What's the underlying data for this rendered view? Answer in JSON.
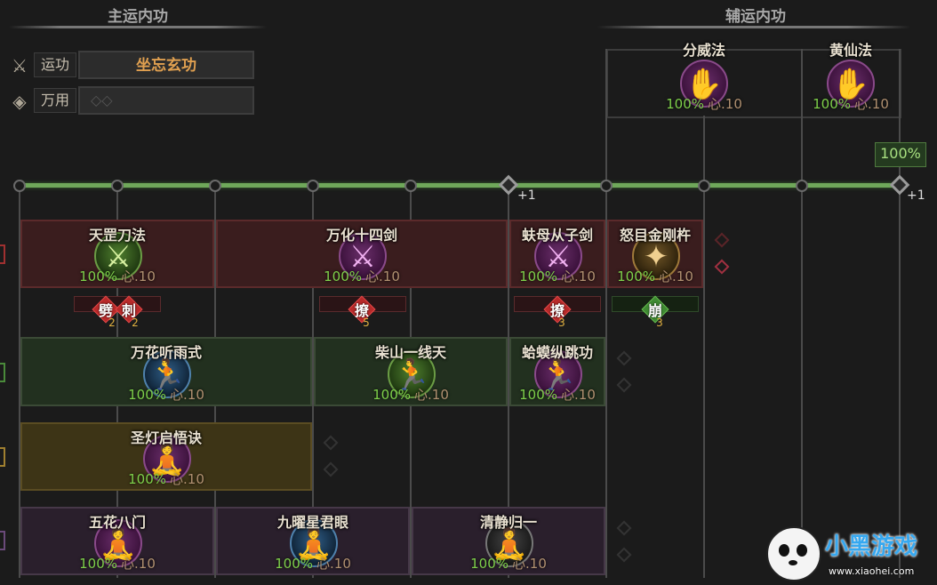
{
  "headers": {
    "main": "主运内功",
    "support": "辅运内功"
  },
  "slots": {
    "yungong": {
      "label": "运功",
      "value": "坐忘玄功"
    },
    "wanyong": {
      "label": "万用",
      "value": "◇◇"
    }
  },
  "support_skills": [
    {
      "name": "分威法",
      "pct": "100%",
      "xin": "心.10",
      "color": "purple"
    },
    {
      "name": "黄仙法",
      "pct": "100%",
      "xin": "心.10",
      "color": "purple"
    }
  ],
  "rail": {
    "plus_1": "+1",
    "plus_2": "+1",
    "progress": "100%"
  },
  "rows": [
    {
      "color": "red",
      "cards": [
        {
          "name": "天罡刀法",
          "pct": "100%",
          "xin": "心.10",
          "icon": "green"
        },
        {
          "name": "万化十四剑",
          "pct": "100%",
          "xin": "心.10",
          "icon": "purple"
        },
        {
          "name": "蚨母从子剑",
          "pct": "100%",
          "xin": "心.10",
          "icon": "purple"
        },
        {
          "name": "怒目金刚杵",
          "pct": "100%",
          "xin": "心.10",
          "icon": "gold"
        }
      ]
    },
    {
      "color": "green",
      "cards": [
        {
          "name": "万花听雨式",
          "pct": "100%",
          "xin": "心.10",
          "icon": "blue"
        },
        {
          "name": "柴山一线天",
          "pct": "100%",
          "xin": "心.10",
          "icon": "green"
        },
        {
          "name": "蛤蟆纵跳功",
          "pct": "100%",
          "xin": "心.10",
          "icon": "purple"
        }
      ]
    },
    {
      "color": "gold",
      "cards": [
        {
          "name": "圣灯启悟诀",
          "pct": "100%",
          "xin": "心.10",
          "icon": "purple"
        }
      ]
    },
    {
      "color": "purple",
      "cards": [
        {
          "name": "五花八门",
          "pct": "100%",
          "xin": "心.10",
          "icon": "purple"
        },
        {
          "name": "九曜星君眼",
          "pct": "100%",
          "xin": "心.10",
          "icon": "blue"
        },
        {
          "name": "清静归一",
          "pct": "100%",
          "xin": "心.10",
          "icon": "gray"
        }
      ]
    }
  ],
  "tags": [
    {
      "text": "劈",
      "num": "2"
    },
    {
      "text": "刺",
      "num": "2"
    },
    {
      "text": "撩",
      "num": "5"
    },
    {
      "text": "撩",
      "num": "3"
    },
    {
      "text": "崩",
      "num": "3"
    }
  ],
  "watermark": {
    "brand": "小黑游戏",
    "url": "www.xiaohei.com"
  }
}
